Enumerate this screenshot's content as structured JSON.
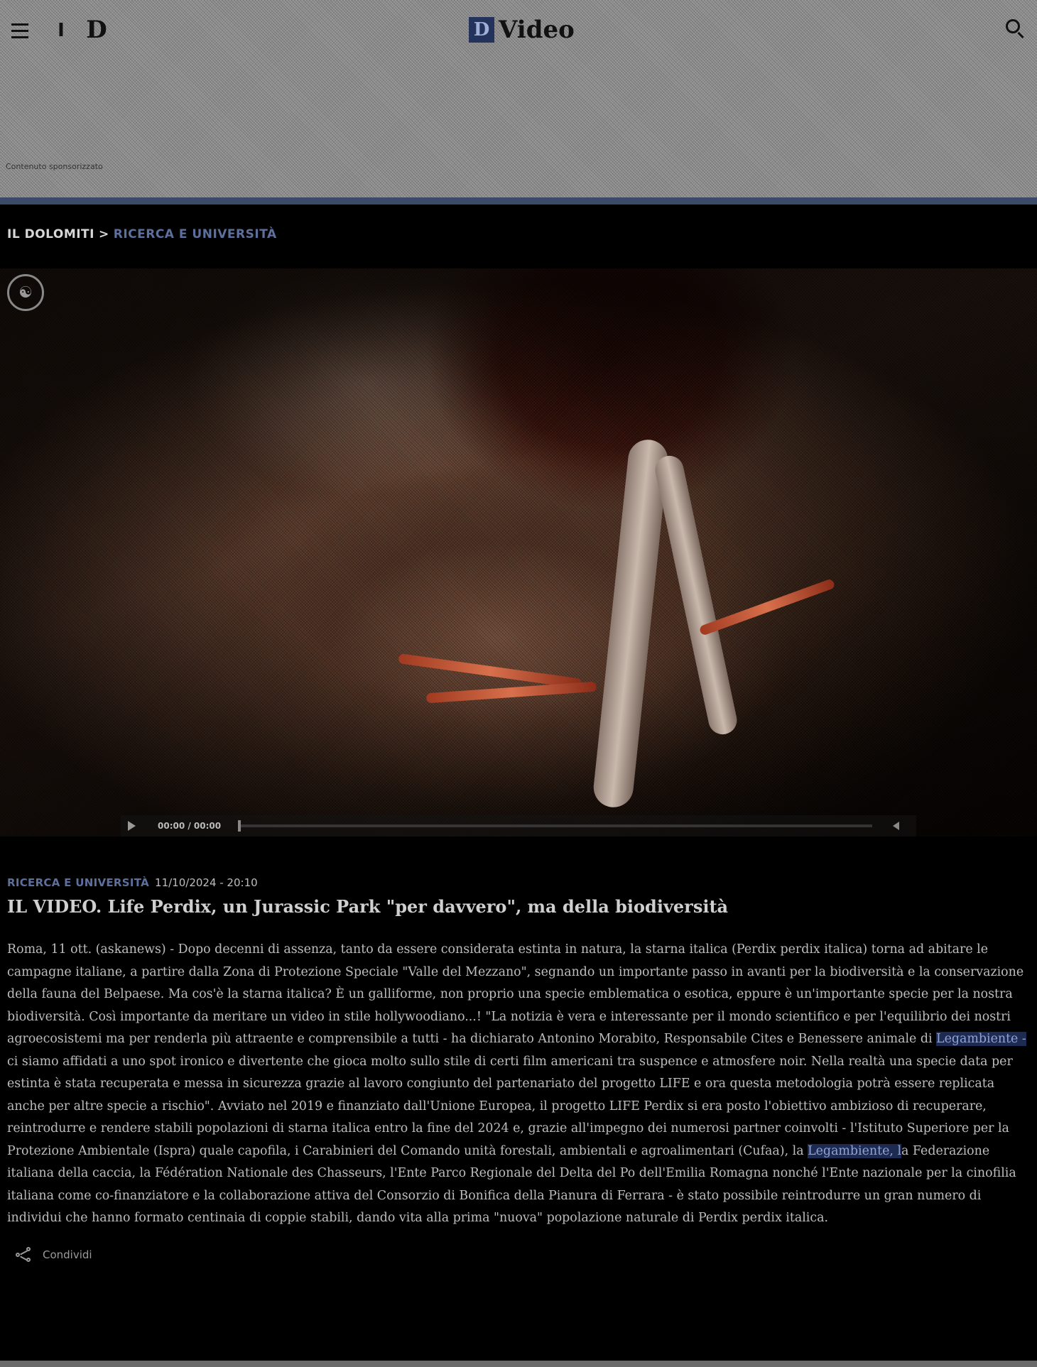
{
  "header": {
    "menu_icon": "hamburger-menu-icon",
    "logo_a": "I",
    "logo_d": "D",
    "brand_mark": "D",
    "brand_text": "Video",
    "search_icon": "search-icon",
    "ad_label": "Contenuto sponsorizzato"
  },
  "breadcrumb": {
    "home": "IL DOLOMITI",
    "separator": ">",
    "current": "RICERCA E UNIVERSITÀ"
  },
  "video": {
    "time": "00:00 / 00:00",
    "progress": 0
  },
  "article": {
    "category": "RICERCA E UNIVERSITÀ",
    "date": "11/10/2024 - 20:10",
    "title": "IL VIDEO. Life Perdix, un Jurassic Park \"per davvero\", ma della biodiversità",
    "body_1": "Roma, 11 ott. (askanews) - Dopo decenni di assenza, tanto da essere considerata estinta in natura, la starna italica (Perdix perdix italica) torna ad abitare le campagne italiane, a partire dalla Zona di Protezione Speciale \"Valle del Mezzano\", segnando un importante passo in avanti per la biodiversità e la conservazione della fauna del Belpaese. Ma cos'è la starna italica? È un galliforme, non proprio una specie emblematica o esotica, eppure è un'importante specie per la nostra biodiversità. Così importante da meritare un video in stile hollywoodiano...! \"La notizia è vera e interessante per il mondo scientifico e per l'equilibrio dei nostri agroecosistemi ma per renderla più attraente e comprensibile a tutti - ha dichiarato Antonino Morabito, Responsabile Cites e Benessere animale di ",
    "link_1": "Legambiente -",
    "body_2": " ci siamo affidati a uno spot ironico e divertente che gioca molto sullo stile di certi film americani tra suspence e atmosfere noir. Nella realtà una specie data per estinta è stata recuperata e messa in sicurezza grazie al lavoro congiunto del partenariato del progetto LIFE e ora questa metodologia potrà essere replicata anche per altre specie a rischio\". Avviato nel 2019 e finanziato dall'Unione Europea, il progetto LIFE Perdix si era posto l'obiettivo ambizioso di recuperare, reintrodurre e rendere stabili popolazioni di starna italica entro la fine del 2024 e, grazie all'impegno dei numerosi partner coinvolti - l'Istituto Superiore per la Protezione Ambientale (Ispra) quale capofila, i Carabinieri del Comando unità forestali, ambientali e agroalimentari (Cufaa), la ",
    "link_2": "Legambiente, l",
    "body_3": "a Federazione italiana della caccia, la Fédération Nationale des Chasseurs, l'Ente Parco Regionale del Delta del Po dell'Emilia Romagna nonché l'Ente nazionale per la cinofilia italiana come co-finanziatore e la collaborazione attiva del Consorzio di Bonifica della Pianura di Ferrara - è stato possibile reintrodurre un gran numero di individui che hanno formato centinaia di coppie stabili, dando vita alla prima \"nuova\" popolazione naturale di Perdix perdix italica."
  },
  "share": {
    "label": "Condividi",
    "icon": "share-icon"
  },
  "colors": {
    "accent": "#5d6f9c",
    "brand_box": "#24335c",
    "link_highlight": "#1d2a52"
  }
}
